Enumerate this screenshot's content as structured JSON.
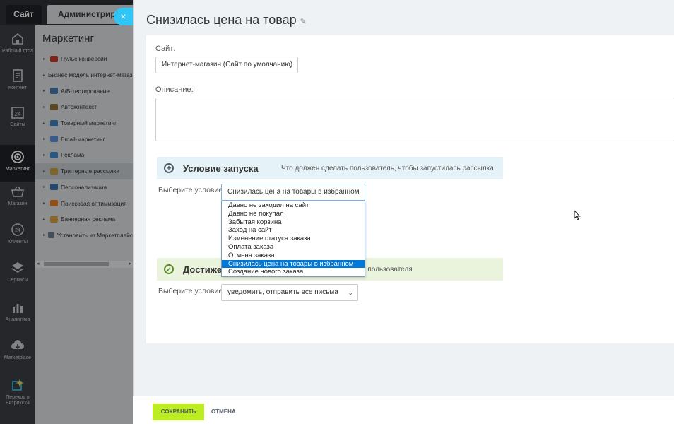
{
  "topbar": {
    "site_tab": "Сайт",
    "admin_tab": "Администрирование"
  },
  "rail": [
    {
      "label": "Рабочий стол",
      "icon": "home-icon"
    },
    {
      "label": "Контент",
      "icon": "document-icon"
    },
    {
      "label": "Сайты",
      "icon": "calendar-24-icon"
    },
    {
      "label": "Маркетинг",
      "icon": "target-icon",
      "active": true
    },
    {
      "label": "Магазин",
      "icon": "basket-icon"
    },
    {
      "label": "Клиенты",
      "icon": "clients-24-icon"
    },
    {
      "label": "Сервисы",
      "icon": "layers-icon"
    },
    {
      "label": "Аналитика",
      "icon": "bar-chart-icon"
    },
    {
      "label": "Marketplace",
      "icon": "cloud-download-icon"
    },
    {
      "label": "Переход в Битрикс24",
      "icon": "bitrix24-icon"
    }
  ],
  "menu": {
    "title": "Маркетинг",
    "items": [
      {
        "label": "Пульс конверсии",
        "color": "#c0392b"
      },
      {
        "label": "Бизнес модель интернет-магазина",
        "color": "#2e7d32"
      },
      {
        "label": "A/B-тестирование",
        "color": "#4a76a8"
      },
      {
        "label": "Автоконтекст",
        "color": "#8a6d3b"
      },
      {
        "label": "Товарный маркетинг",
        "color": "#3d7ab8"
      },
      {
        "label": "Email-маркетинг",
        "color": "#5b8bd0"
      },
      {
        "label": "Реклама",
        "color": "#3f86c4"
      },
      {
        "label": "Триггерные рассылки",
        "color": "#c49a3a",
        "active": true
      },
      {
        "label": "Персонализация",
        "color": "#3a6ea5"
      },
      {
        "label": "Поисковая оптимизация",
        "color": "#e07b24"
      },
      {
        "label": "Баннерная реклама",
        "color": "#d69c3c"
      },
      {
        "label": "Установить из Маркетплейс",
        "color": "#6b7a89"
      }
    ],
    "scroll_left": "◂",
    "scroll_right": "▸"
  },
  "close_glyph": "×",
  "form": {
    "title": "Снизилась цена на товар",
    "edit_glyph": "✎",
    "site_label": "Сайт:",
    "site_value": "Интернет-магазин (Сайт по умолчанию)",
    "description_label": "Описание:",
    "description_value": "",
    "condition_title": "Условие запуска",
    "condition_hint": "Что должен сделать пользователь, чтобы запустилась рассылка",
    "choose_label": "Выберите условие",
    "condition_value": "Снизилась цена на товары в избранном",
    "condition_options": [
      "Давно не заходил на сайт",
      "Давно не покупал",
      "Забытая корзина",
      "Заход на сайт",
      "Изменение статуса заказа",
      "Оплата заказа",
      "Отмена заказа",
      "Снизилась цена на товары в избранном",
      "Создание нового заказа"
    ],
    "selected_option_index": 7,
    "goal_title": "Достижение цели",
    "goal_hint": "Какое действие ждем от пользователя",
    "goal_title_visible": "Достиже",
    "goal_hint_visible": "л от пользователя",
    "goal_choose_label": "Выберите условие",
    "goal_value": "уведомить, отправить все письма"
  },
  "footer": {
    "save_label": "СОХРАНИТЬ",
    "cancel_label": "ОТМЕНА"
  },
  "colors": {
    "accent": "#2fc6f6",
    "save": "#bbed21",
    "selection": "#0078d7"
  }
}
